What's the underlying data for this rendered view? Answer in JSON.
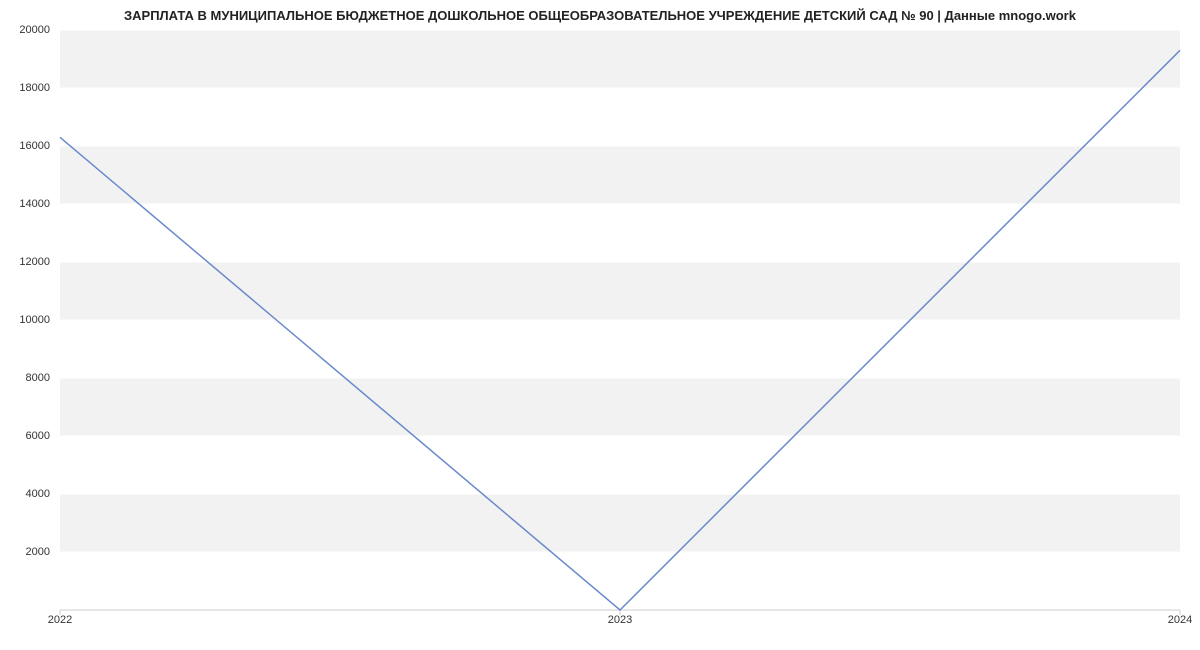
{
  "chart_data": {
    "type": "line",
    "title": "ЗАРПЛАТА В МУНИЦИПАЛЬНОЕ БЮДЖЕТНОЕ ДОШКОЛЬНОЕ ОБЩЕОБРАЗОВАТЕЛЬНОЕ УЧРЕЖДЕНИЕ ДЕТСКИЙ САД № 90 | Данные mnogo.work",
    "x": [
      "2022",
      "2023",
      "2024"
    ],
    "series": [
      {
        "name": "Зарплата",
        "values": [
          16300,
          0,
          19300
        ]
      }
    ],
    "xlabel": "",
    "ylabel": "",
    "ylim": [
      0,
      20000
    ],
    "y_ticks": [
      2000,
      4000,
      6000,
      8000,
      10000,
      12000,
      14000,
      16000,
      18000,
      20000
    ],
    "grid": true,
    "line_color": "#6a89cc"
  }
}
